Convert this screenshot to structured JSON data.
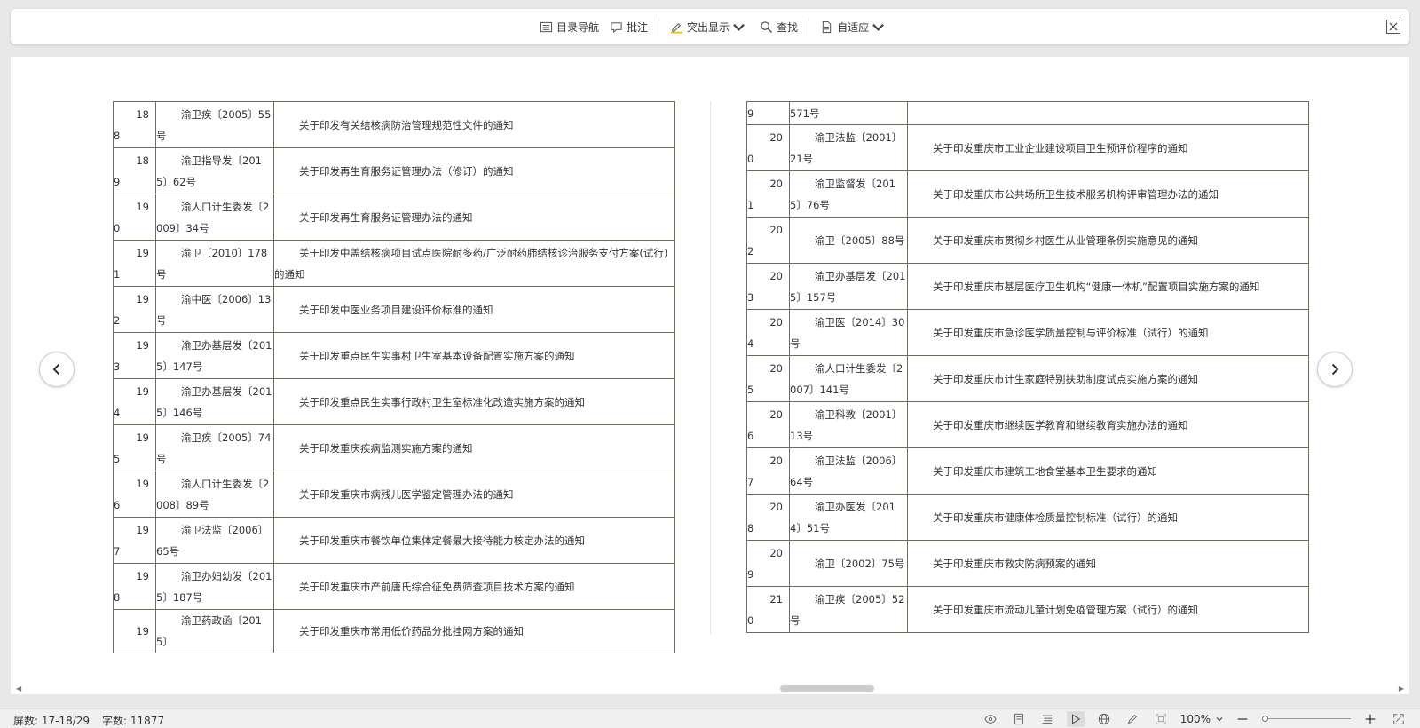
{
  "toolbar": {
    "toc_label": "目录导航",
    "comment_label": "批注",
    "highlight_label": "突出显示",
    "find_label": "查找",
    "fit_label": "自适应"
  },
  "left_rows": [
    {
      "num_a": "18",
      "num_b": "8",
      "code": "渝卫疾〔2005〕55号",
      "title": "关于印发有关结核病防治管理规范性文件的通知"
    },
    {
      "num_a": "18",
      "num_b": "9",
      "code": "渝卫指导发〔2015〕62号",
      "title": "关于印发再生育服务证管理办法（修订）的通知"
    },
    {
      "num_a": "19",
      "num_b": "0",
      "code": "渝人口计生委发〔2009〕34号",
      "title": "关于印发再生育服务证管理办法的通知"
    },
    {
      "num_a": "19",
      "num_b": "1",
      "code": "渝卫〔2010〕178号",
      "title": "关于印发中盖结核病项目试点医院耐多药/广泛耐药肺结核诊治服务支付方案(试行)的通知"
    },
    {
      "num_a": "19",
      "num_b": "2",
      "code": "渝中医〔2006〕13号",
      "title": "关于印发中医业务项目建设评价标准的通知"
    },
    {
      "num_a": "19",
      "num_b": "3",
      "code": "渝卫办基层发〔2015〕147号",
      "title": "关于印发重点民生实事村卫生室基本设备配置实施方案的通知"
    },
    {
      "num_a": "19",
      "num_b": "4",
      "code": "渝卫办基层发〔2015〕146号",
      "title": "关于印发重点民生实事行政村卫生室标准化改造实施方案的通知"
    },
    {
      "num_a": "19",
      "num_b": "5",
      "code": "渝卫疾〔2005〕74号",
      "title": "关于印发重庆疾病监测实施方案的通知"
    },
    {
      "num_a": "19",
      "num_b": "6",
      "code": "渝人口计生委发〔2008〕89号",
      "title": "关于印发重庆市病残儿医学鉴定管理办法的通知"
    },
    {
      "num_a": "19",
      "num_b": "7",
      "code": "渝卫法监〔2006〕65号",
      "title": "关于印发重庆市餐饮单位集体定餐最大接待能力核定办法的通知"
    },
    {
      "num_a": "19",
      "num_b": "8",
      "code": "渝卫办妇幼发〔2015〕187号",
      "title": "关于印发重庆市产前唐氏综合征免费筛查项目技术方案的通知"
    },
    {
      "num_a": "19",
      "num_b": "",
      "code": "渝卫药政函〔2015〕",
      "title": "关于印发重庆市常用低价药品分批挂网方案的通知"
    }
  ],
  "right_rows": [
    {
      "num_a": "",
      "num_b": "9",
      "code": "571号",
      "title": ""
    },
    {
      "num_a": "20",
      "num_b": "0",
      "code": "渝卫法监〔2001〕21号",
      "title": "关于印发重庆市工业企业建设项目卫生预评价程序的通知"
    },
    {
      "num_a": "20",
      "num_b": "1",
      "code": "渝卫监督发〔2015〕76号",
      "title": "关于印发重庆市公共场所卫生技术服务机构评审管理办法的通知"
    },
    {
      "num_a": "20",
      "num_b": "2",
      "code": "渝卫〔2005〕88号",
      "title": "关于印发重庆市贯彻乡村医生从业管理条例实施意见的通知"
    },
    {
      "num_a": "20",
      "num_b": "3",
      "code": "渝卫办基层发〔2015〕157号",
      "title": "关于印发重庆市基层医疗卫生机构“健康一体机”配置项目实施方案的通知"
    },
    {
      "num_a": "20",
      "num_b": "4",
      "code": "渝卫医〔2014〕30号",
      "title": "关于印发重庆市急诊医学质量控制与评价标准（试行）的通知"
    },
    {
      "num_a": "20",
      "num_b": "5",
      "code": "渝人口计生委发〔2007〕141号",
      "title": "关于印发重庆市计生家庭特别扶助制度试点实施方案的通知"
    },
    {
      "num_a": "20",
      "num_b": "6",
      "code": "渝卫科教〔2001〕13号",
      "title": "关于印发重庆市继续医学教育和继续教育实施办法的通知"
    },
    {
      "num_a": "20",
      "num_b": "7",
      "code": "渝卫法监〔2006〕64号",
      "title": "关于印发重庆市建筑工地食堂基本卫生要求的通知"
    },
    {
      "num_a": "20",
      "num_b": "8",
      "code": "渝卫办医发〔2014〕51号",
      "title": "关于印发重庆市健康体检质量控制标准（试行）的通知"
    },
    {
      "num_a": "20",
      "num_b": "9",
      "code": "渝卫〔2002〕75号",
      "title": "关于印发重庆市救灾防病预案的通知"
    },
    {
      "num_a": "21",
      "num_b": "0",
      "code": "渝卫疾〔2005〕52号",
      "title": "关于印发重庆市流动儿童计划免疫管理方案（试行）的通知"
    }
  ],
  "status": {
    "screen_label": "屏数: 17-18/29",
    "word_label": "字数: 11877",
    "zoom_label": "100%",
    "zoom_fraction": 0.0
  },
  "colors": {
    "table_border": "#6d6b5f",
    "highlight_icon": "#e8c21a"
  }
}
